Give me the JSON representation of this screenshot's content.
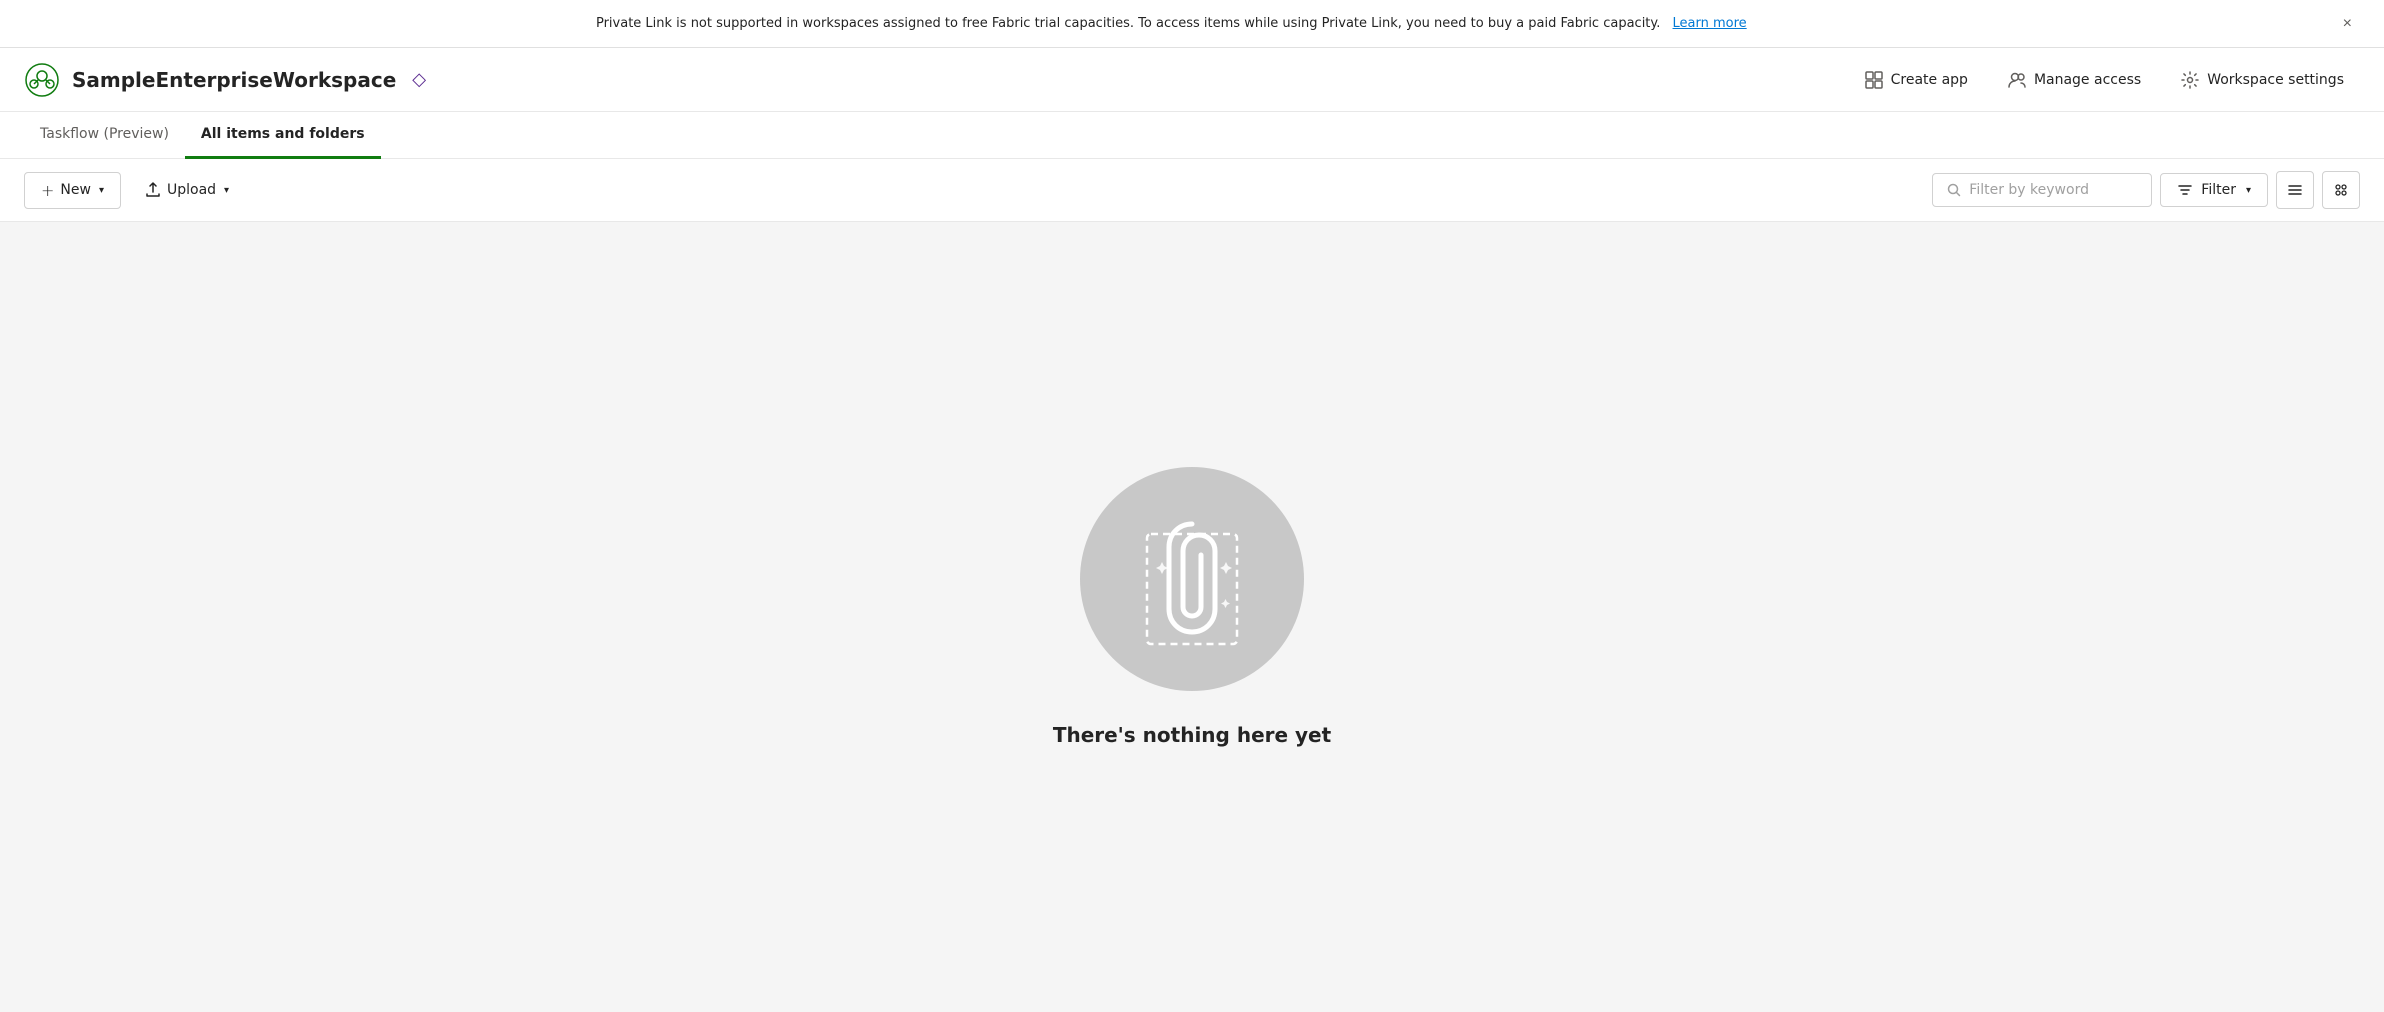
{
  "banner": {
    "message": "Private Link is not supported in workspaces assigned to free Fabric trial capacities. To access items while using Private Link, you need to buy a paid Fabric capacity.",
    "link_text": "Learn more",
    "close_label": "×"
  },
  "header": {
    "workspace_name": "SampleEnterpriseWorkspace",
    "diamond_icon": "◇",
    "actions": {
      "create_app": "Create app",
      "manage_access": "Manage access",
      "workspace_settings": "Workspace settings"
    }
  },
  "tabs": [
    {
      "id": "taskflow",
      "label": "Taskflow (Preview)",
      "active": false
    },
    {
      "id": "all-items",
      "label": "All items and folders",
      "active": true
    }
  ],
  "toolbar": {
    "new_button": "New",
    "upload_button": "Upload",
    "filter_placeholder": "Filter by keyword",
    "filter_button": "Filter"
  },
  "empty_state": {
    "title": "There's nothing here yet"
  }
}
